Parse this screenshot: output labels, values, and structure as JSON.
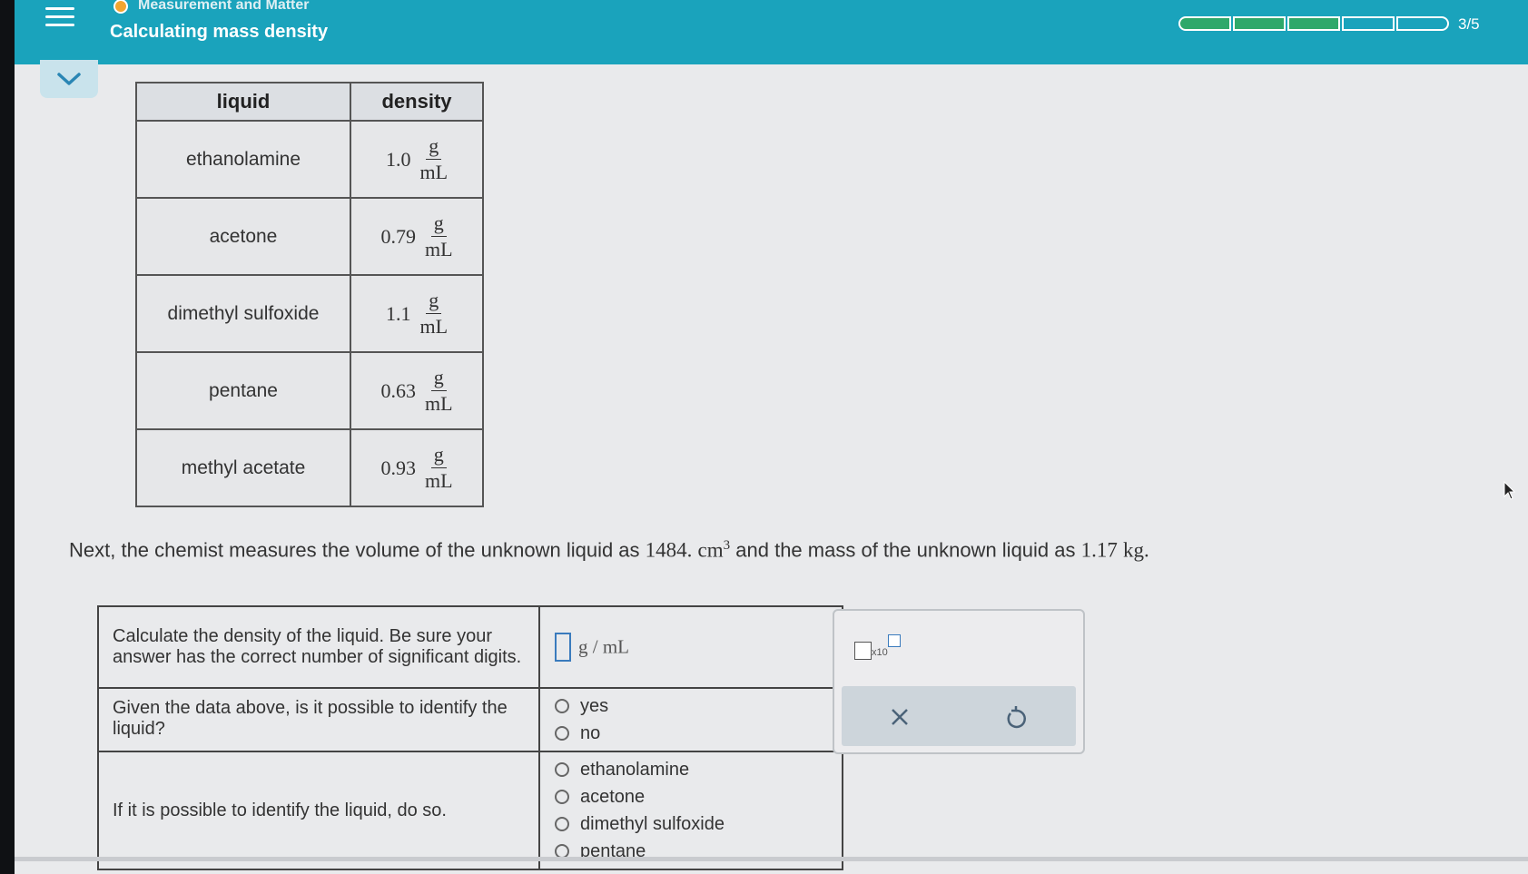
{
  "header": {
    "topic": "Measurement and Matter",
    "title": "Calculating mass density",
    "progress_label": "3/5",
    "progress_filled": 3,
    "progress_total": 5,
    "accent_color": "#1aa3bc",
    "progress_color": "#2fa86a"
  },
  "density_table": {
    "headers": [
      "liquid",
      "density"
    ],
    "unit_num": "g",
    "unit_den": "mL",
    "rows": [
      {
        "liquid": "ethanolamine",
        "density": "1.0"
      },
      {
        "liquid": "acetone",
        "density": "0.79"
      },
      {
        "liquid": "dimethyl sulfoxide",
        "density": "1.1"
      },
      {
        "liquid": "pentane",
        "density": "0.63"
      },
      {
        "liquid": "methyl acetate",
        "density": "0.93"
      }
    ]
  },
  "sentence": {
    "part1": "Next, the chemist measures the volume of the unknown liquid as ",
    "volume": "1484.",
    "volume_unit": "cm",
    "volume_exp": "3",
    "part2": " and the mass of the unknown liquid as ",
    "mass": "1.17",
    "mass_unit": "kg",
    "end": "."
  },
  "questions": {
    "q1": "Calculate the density of the liquid. Be sure your answer has the correct number of significant digits.",
    "q1_unit": "g / mL",
    "q2": "Given the data above, is it possible to identify the liquid?",
    "q2_options": [
      "yes",
      "no"
    ],
    "q3": "If it is possible to identify the liquid, do so.",
    "q3_options": [
      "ethanolamine",
      "acetone",
      "dimethyl sulfoxide",
      "pentane"
    ]
  },
  "panel": {
    "x10_label": "x10",
    "clear_icon": "close-icon",
    "undo_icon": "undo-icon"
  }
}
